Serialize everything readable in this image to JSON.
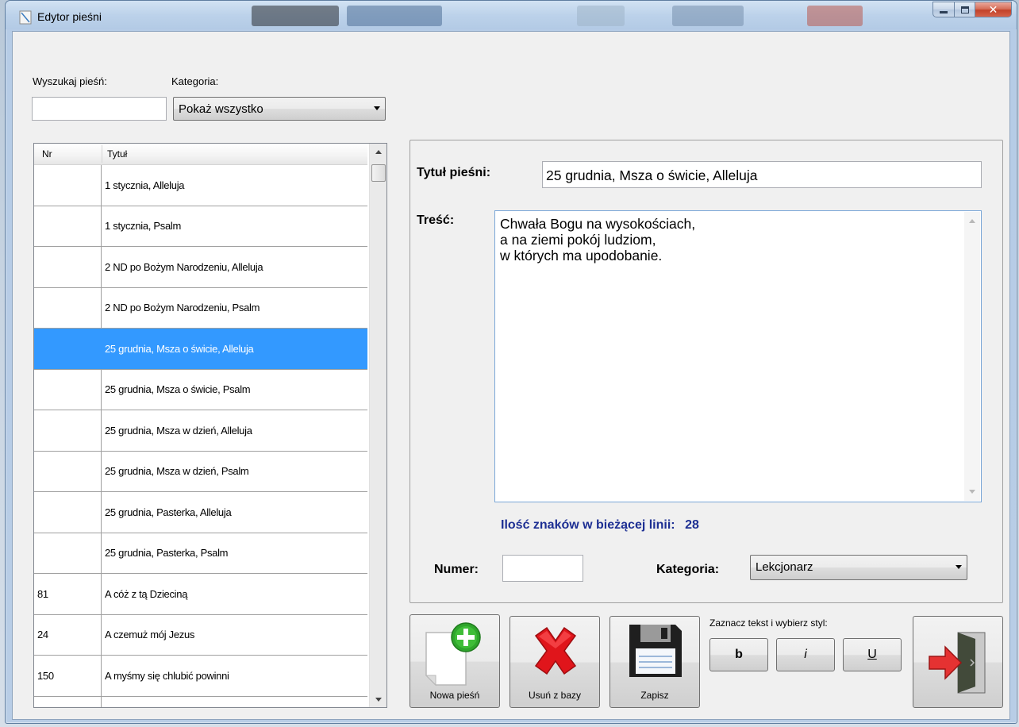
{
  "window": {
    "title": "Edytor pieśni"
  },
  "search": {
    "label": "Wyszukaj pieśń:",
    "value": ""
  },
  "category_filter": {
    "label": "Kategoria:",
    "selected": "Pokaż wszystko"
  },
  "song_list": {
    "columns": [
      "Nr",
      "Tytuł"
    ],
    "rows": [
      {
        "nr": "",
        "title": "1 stycznia, Alleluja"
      },
      {
        "nr": "",
        "title": "1 stycznia, Psalm"
      },
      {
        "nr": "",
        "title": "2 ND po Bożym Narodzeniu, Alleluja"
      },
      {
        "nr": "",
        "title": "2 ND po Bożym Narodzeniu, Psalm"
      },
      {
        "nr": "",
        "title": "25 grudnia, Msza o świcie, Alleluja",
        "selected": true
      },
      {
        "nr": "",
        "title": "25 grudnia, Msza o świcie, Psalm"
      },
      {
        "nr": "",
        "title": "25 grudnia, Msza w dzień, Alleluja"
      },
      {
        "nr": "",
        "title": "25 grudnia, Msza w dzień, Psalm"
      },
      {
        "nr": "",
        "title": "25 grudnia, Pasterka, Alleluja"
      },
      {
        "nr": "",
        "title": "25 grudnia, Pasterka, Psalm"
      },
      {
        "nr": "81",
        "title": "A cóż z tą Dzieciną"
      },
      {
        "nr": "24",
        "title": "A czemuż mój Jezus"
      },
      {
        "nr": "150",
        "title": "A myśmy się chlubić powinni"
      },
      {
        "nr": "",
        "title": ""
      }
    ]
  },
  "editor": {
    "title_label": "Tytuł pieśni:",
    "title_value": "25 grudnia, Msza o świcie, Alleluja",
    "content_label": "Treść:",
    "content_value": "Chwała Bogu na wysokościach,\na na ziemi pokój ludziom,\nw których ma upodobanie.",
    "char_count_label": "Ilość znaków w bieżącej linii:",
    "char_count_value": "28",
    "number_label": "Numer:",
    "number_value": "",
    "category_label": "Kategoria:",
    "category_value": "Lekcjonarz"
  },
  "buttons": {
    "new_song": "Nowa pieśń",
    "delete": "Usuń z bazy",
    "save": "Zapisz",
    "style_hint": "Zaznacz tekst i wybierz styl:",
    "bold": "b",
    "italic": "i",
    "underline": "U"
  },
  "icons": {
    "new_song": "new-document-plus-icon",
    "delete": "red-x-icon",
    "save": "floppy-disk-icon",
    "exit": "exit-door-icon"
  },
  "colors": {
    "selection": "#3399ff",
    "char_count": "#1d2f93",
    "delete_red": "#e0151b",
    "add_green": "#2fa52c"
  }
}
